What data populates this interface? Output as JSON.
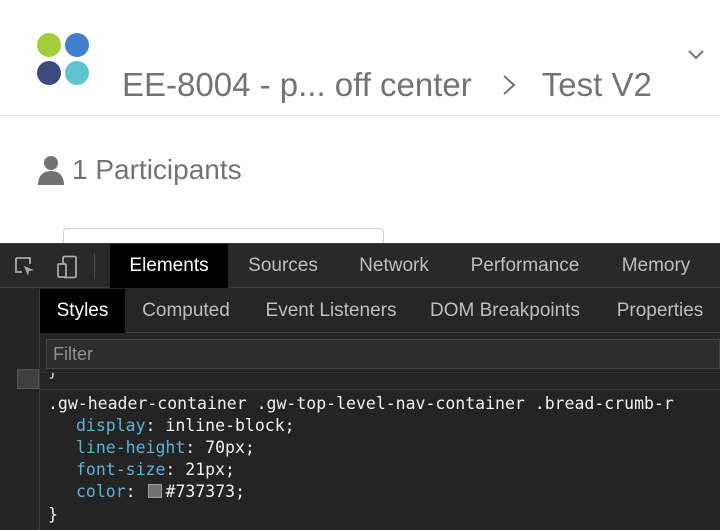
{
  "header": {
    "logo_colors": [
      "#a4cd3c",
      "#3f7fce",
      "#3c4a7c",
      "#5ec5d0"
    ],
    "breadcrumb": [
      {
        "label": "EE-8004 - p... off center"
      },
      {
        "label": "Test V2"
      }
    ],
    "separator_icon": "chevron-right-icon",
    "menu_icon": "chevron-down-icon"
  },
  "participants": {
    "icon": "person-icon",
    "label": "1 Participants"
  },
  "devtools": {
    "tools": [
      "inspect-element-icon",
      "device-toolbar-icon"
    ],
    "tabs": [
      {
        "label": "Elements",
        "active": true
      },
      {
        "label": "Sources",
        "active": false
      },
      {
        "label": "Network",
        "active": false
      },
      {
        "label": "Performance",
        "active": false
      },
      {
        "label": "Memory",
        "active": false
      }
    ],
    "sub_tabs": [
      {
        "label": "Styles",
        "active": true
      },
      {
        "label": "Computed",
        "active": false
      },
      {
        "label": "Event Listeners",
        "active": false
      },
      {
        "label": "DOM Breakpoints",
        "active": false
      },
      {
        "label": "Properties",
        "active": false
      }
    ],
    "filter_placeholder": "Filter",
    "styles": {
      "prev_close": "}",
      "selector": ".gw-header-container .gw-top-level-nav-container .bread-crumb-r",
      "declarations": [
        {
          "property": "display",
          "value": "inline-block;"
        },
        {
          "property": "line-height",
          "value": "70px;"
        },
        {
          "property": "font-size",
          "value": "21px;"
        },
        {
          "property": "color",
          "value": "#737373;",
          "swatch": "#737373"
        }
      ],
      "close": "}"
    }
  }
}
